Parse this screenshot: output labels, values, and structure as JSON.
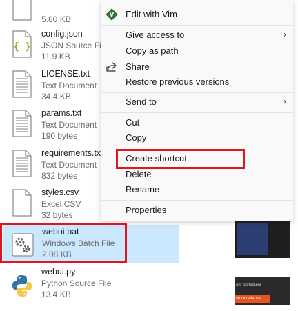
{
  "files": [
    {
      "name": "",
      "type": "",
      "size": "5.80 KB",
      "icon": "generic-file-icon"
    },
    {
      "name": "config.json",
      "type": "JSON Source File",
      "size": "11.9 KB",
      "icon": "json-file-icon"
    },
    {
      "name": "LICENSE.txt",
      "type": "Text Document",
      "size": "34.4 KB",
      "icon": "text-file-icon"
    },
    {
      "name": "params.txt",
      "type": "Text Document",
      "size": "190 bytes",
      "icon": "text-file-icon"
    },
    {
      "name": "requirements.txt",
      "type": "Text Document",
      "size": "832 bytes",
      "icon": "text-file-icon"
    },
    {
      "name": "styles.csv",
      "type": "Excel.CSV",
      "size": "32 bytes",
      "icon": "generic-file-icon"
    },
    {
      "name": "webui.bat",
      "type": "Windows Batch File",
      "size": "2.08 KB",
      "icon": "batch-file-icon"
    },
    {
      "name": "webui.py",
      "type": "Python Source File",
      "size": "13.4 KB",
      "icon": "python-file-icon"
    }
  ],
  "context_menu": {
    "items": [
      {
        "label": "Edit with Vim",
        "icon": "vim-icon",
        "has_submenu": false
      },
      {
        "label": "Give access to",
        "icon": "",
        "has_submenu": true
      },
      {
        "label": "Copy as path",
        "icon": "",
        "has_submenu": false
      },
      {
        "label": "Share",
        "icon": "share-icon",
        "has_submenu": false
      },
      {
        "label": "Restore previous versions",
        "icon": "",
        "has_submenu": false
      },
      {
        "label": "Send to",
        "icon": "",
        "has_submenu": true
      },
      {
        "label": "Cut",
        "icon": "",
        "has_submenu": false
      },
      {
        "label": "Copy",
        "icon": "",
        "has_submenu": false
      },
      {
        "label": "Create shortcut",
        "icon": "",
        "has_submenu": false
      },
      {
        "label": "Delete",
        "icon": "",
        "has_submenu": false
      },
      {
        "label": "Rename",
        "icon": "",
        "has_submenu": false
      },
      {
        "label": "Properties",
        "icon": "",
        "has_submenu": false
      }
    ],
    "submenu_arrow": "›"
  },
  "background_window": {
    "label_1": "ent Scheduler",
    "label_2": "store defaults"
  },
  "colors": {
    "highlight": "#e0161f",
    "selection_bg": "#cce8ff",
    "menu_bg": "#f9f9f9"
  }
}
